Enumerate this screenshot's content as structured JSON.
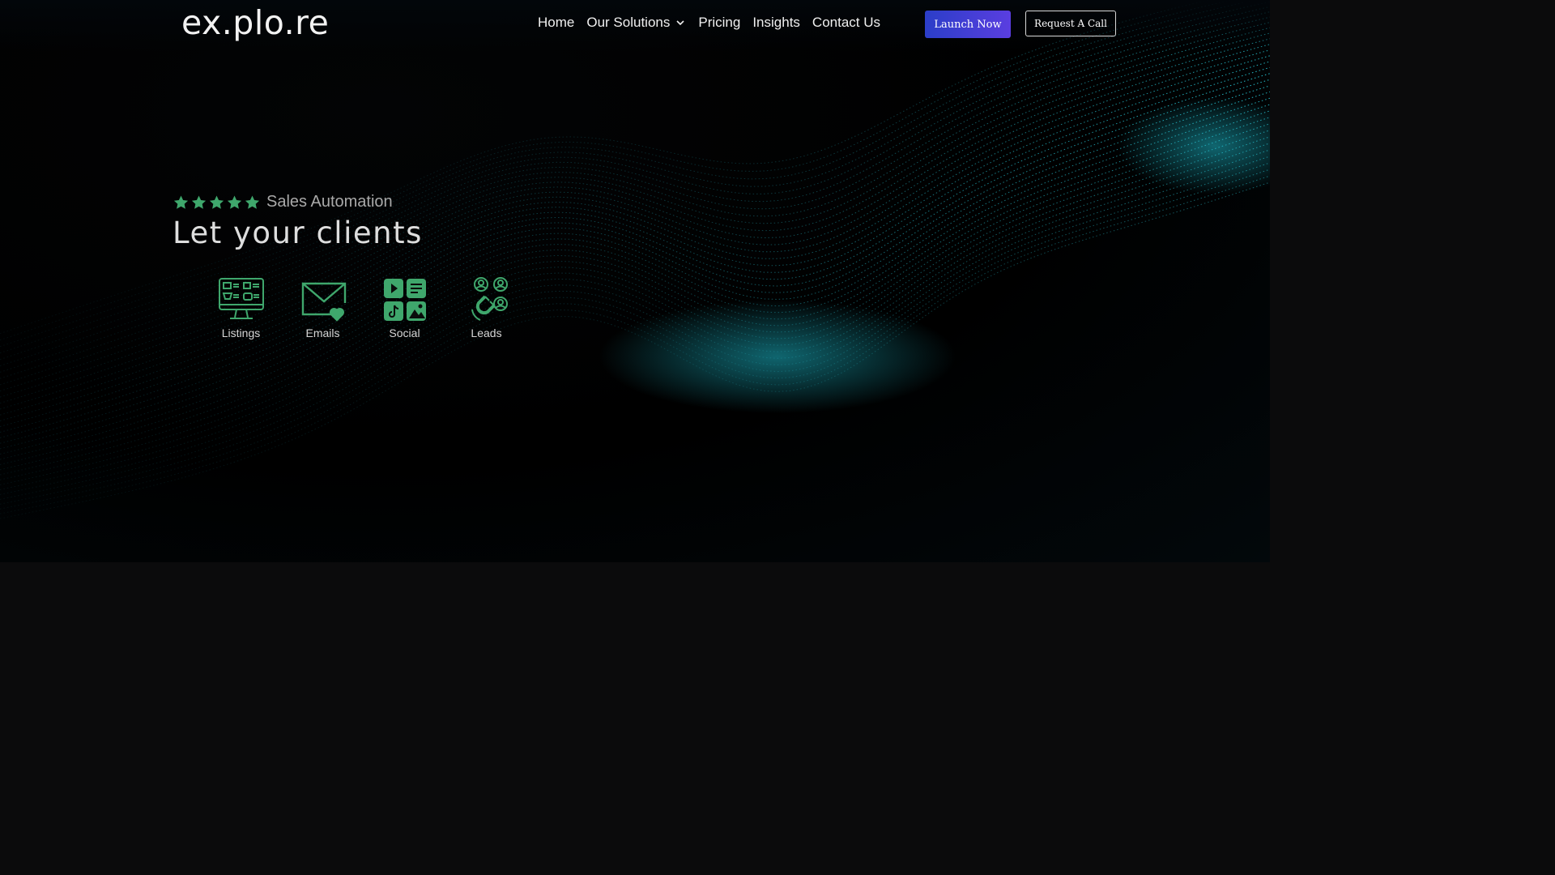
{
  "header": {
    "logo": "ex.plo.re",
    "nav": [
      {
        "label": "Home"
      },
      {
        "label": "Our Solutions",
        "has_dropdown": true
      },
      {
        "label": "Pricing"
      },
      {
        "label": "Insights"
      },
      {
        "label": "Contact Us"
      }
    ],
    "launch_label": "Launch Now",
    "call_label": "Request A Call"
  },
  "hero": {
    "rating_stars": 5,
    "tagline": "Sales Automation",
    "headline": "Let your clients",
    "features": [
      {
        "label": "Listings",
        "icon": "listings-monitor-icon"
      },
      {
        "label": "Emails",
        "icon": "email-heart-icon"
      },
      {
        "label": "Social",
        "icon": "social-media-icon"
      },
      {
        "label": "Leads",
        "icon": "lead-magnet-icon"
      }
    ]
  },
  "colors": {
    "accent_green": "#3fa76c",
    "launch_gradient_start": "#2b3ec8",
    "launch_gradient_end": "#5a3ee0",
    "wave_teal": "#22c6d8",
    "background": "#0b0b0c"
  }
}
